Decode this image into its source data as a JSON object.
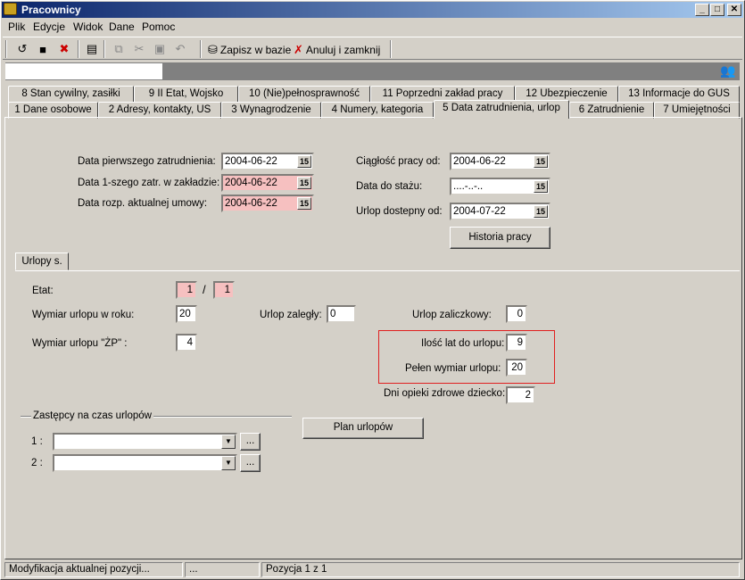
{
  "window": {
    "title": "Pracownicy"
  },
  "menu": [
    "Plik",
    "Edycje",
    "Widok",
    "Dane",
    "Pomoc"
  ],
  "toolbar": {
    "save_label": "Zapisz w bazie",
    "cancel_label": "Anuluj i zamknij",
    "icons": [
      "undo-icon",
      "save-icon",
      "delete-icon",
      "properties-icon",
      "copy-icon",
      "cut-icon",
      "paste-icon",
      "back-icon",
      "db-save-icon",
      "cancel-icon"
    ]
  },
  "tabs_row1": [
    "8 Stan cywilny, zasiłki",
    "9 II Etat, Wojsko",
    "10 (Nie)pełnosprawność",
    "11 Poprzedni zakład pracy",
    "12 Ubezpieczenie",
    "13 Informacje do GUS"
  ],
  "tabs_row2": [
    "1 Dane osobowe",
    "2 Adresy, kontakty, US",
    "3 Wynagrodzenie",
    "4 Numery, kategoria",
    "5 Data zatrudnienia, urlop",
    "6 Zatrudnienie",
    "7 Umiejętności"
  ],
  "form": {
    "data_pierwszego_label": "Data pierwszego zatrudnienia:",
    "data_pierwszego": "2004-06-22",
    "data_1szego_label": "Data 1-szego zatr. w zakładzie:",
    "data_1szego": "2004-06-22",
    "data_rozp_label": "Data rozp. aktualnej umowy:",
    "data_rozp": "2004-06-22",
    "ciaglosc_label": "Ciągłość pracy od:",
    "ciaglosc": "2004-06-22",
    "data_stazu_label": "Data do stażu:",
    "data_stazu": "....-..-..",
    "urlop_dost_label": "Urlop dostepny od:",
    "urlop_dost": "2004-07-22",
    "historia_button": "Historia pracy",
    "cal_glyph": "15"
  },
  "urlopy": {
    "tab_label": "Urlopy s.",
    "etat_label": "Etat:",
    "etat_num": "1",
    "etat_sep": "/",
    "etat_den": "1",
    "wymiar_label": "Wymiar urlopu w roku:",
    "wymiar": "20",
    "zalegly_label": "Urlop zaległy:",
    "zalegly": "0",
    "zaliczkowy_label": "Urlop zaliczkowy:",
    "zaliczkowy": "0",
    "zp_label": "Wymiar urlopu \"ŻP\" :",
    "zp": "4",
    "lat_label": "Ilość lat do urlopu:",
    "lat": "9",
    "pelen_label": "Pełen wymiar urlopu:",
    "pelen": "20",
    "opieki_label": "Dni opieki zdrowe dziecko:",
    "opieki": "2",
    "zastepcy_label": "Zastępcy na czas urlopów",
    "z1_label": "1 :",
    "z2_label": "2 :",
    "plan_button": "Plan urlopów",
    "dots": "...",
    "highlight_color": "#e02020"
  },
  "status": {
    "msg": "Modyfikacja aktualnej pozycji...",
    "mid": "...",
    "pos": "Pozycja 1 z 1"
  }
}
